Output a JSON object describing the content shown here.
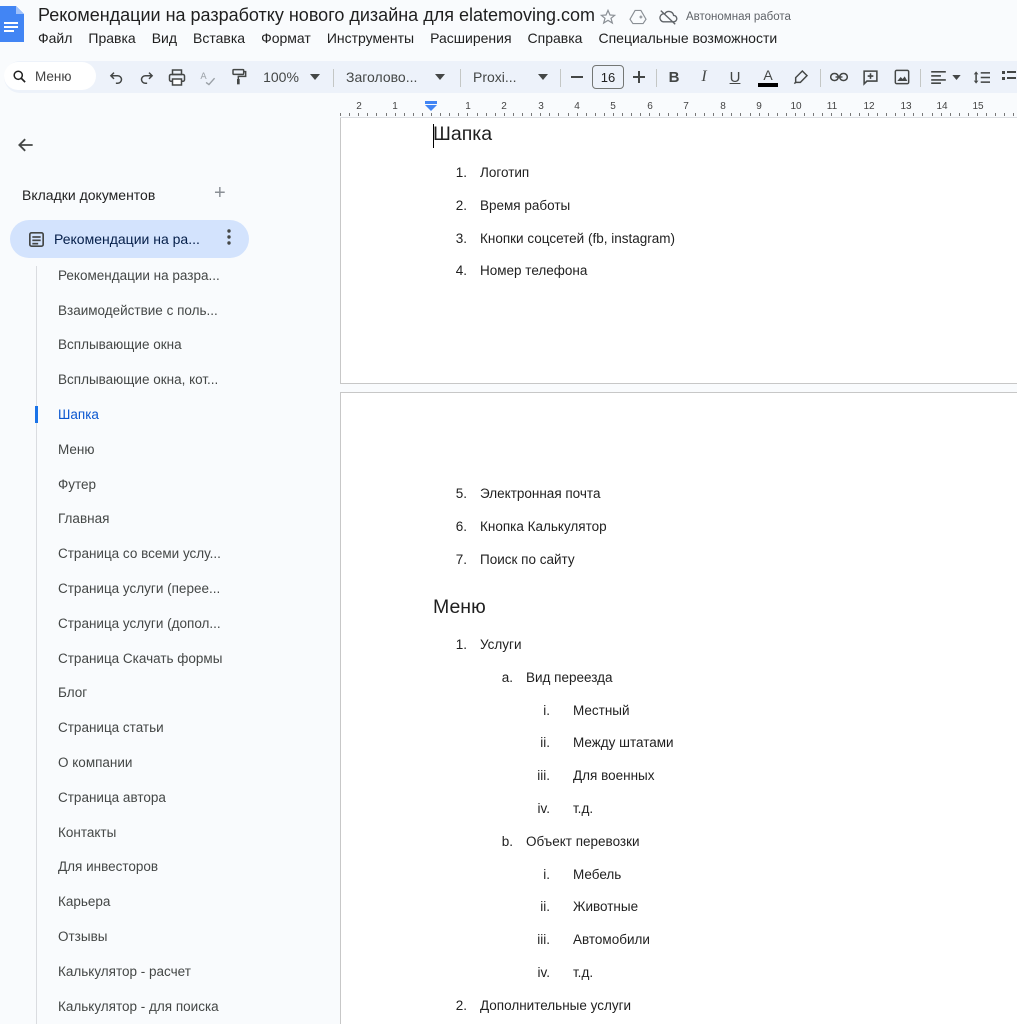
{
  "app": {
    "title": "Рекомендации на разработку нового дизайна для elatemoving.com",
    "offline_label": "Автономная работа",
    "menu": [
      "Файл",
      "Правка",
      "Вид",
      "Вставка",
      "Формат",
      "Инструменты",
      "Расширения",
      "Справка",
      "Специальные возможности"
    ]
  },
  "toolbar": {
    "menu_label": "Меню",
    "zoom": "100%",
    "style": "Заголово...",
    "font": "Proxi...",
    "font_size": "16",
    "text_color": "#000000"
  },
  "ruler": {
    "numbers": [
      "2",
      "1",
      "1",
      "2",
      "3",
      "4",
      "5",
      "6",
      "7",
      "8",
      "9",
      "10",
      "11",
      "12",
      "13",
      "14",
      "15"
    ]
  },
  "sidebar": {
    "header": "Вкладки документов",
    "add_symbol": "+",
    "active_tab": "Рекомендации на ра...",
    "outline": [
      "Рекомендации на разра...",
      "Взаимодействие с поль...",
      "Всплывающие окна",
      "Всплывающие окна, кот...",
      "Шапка",
      "Меню",
      "Футер",
      "Главная",
      "Страница со всеми услу...",
      "Страница услуги (переe...",
      "Страница услуги (допол...",
      "Страница Скачать формы",
      "Блог",
      "Страница статьи",
      "О компании",
      "Страница автора",
      "Контакты",
      "Для инвесторов",
      "Карьера",
      "Отзывы",
      "Калькулятор - расчет",
      "Калькулятор - для поиска"
    ],
    "active_outline_index": 4
  },
  "doc": {
    "page1": {
      "heading": "Шапка",
      "items": [
        {
          "n": "1.",
          "t": "Логотип"
        },
        {
          "n": "2.",
          "t": "Время работы"
        },
        {
          "n": "3.",
          "t": "Кнопки соцсетей (fb, instagram)"
        },
        {
          "n": "4.",
          "t": "Номер телефона"
        }
      ]
    },
    "page2": {
      "items": [
        {
          "n": "5.",
          "t": "Электронная почта"
        },
        {
          "n": "6.",
          "t": "Кнопка Калькулятор"
        },
        {
          "n": "7.",
          "t": "Поиск по сайту"
        }
      ],
      "heading": "Меню",
      "menu_items": [
        {
          "n": "1.",
          "t": "Услуги",
          "level": 0
        },
        {
          "n": "a.",
          "t": "Вид переезда",
          "level": 1
        },
        {
          "n": "i.",
          "t": "Местный",
          "level": 2
        },
        {
          "n": "ii.",
          "t": "Между штатами",
          "level": 2
        },
        {
          "n": "iii.",
          "t": "Для военных",
          "level": 2
        },
        {
          "n": "iv.",
          "t": "т.д.",
          "level": 2
        },
        {
          "n": "b.",
          "t": "Объект перевозки",
          "level": 1
        },
        {
          "n": "i.",
          "t": "Мебель",
          "level": 2
        },
        {
          "n": "ii.",
          "t": "Животные",
          "level": 2
        },
        {
          "n": "iii.",
          "t": "Автомобили",
          "level": 2
        },
        {
          "n": "iv.",
          "t": "т.д.",
          "level": 2
        },
        {
          "n": "2.",
          "t": "Дополнительные услуги",
          "level": 0
        }
      ]
    }
  }
}
